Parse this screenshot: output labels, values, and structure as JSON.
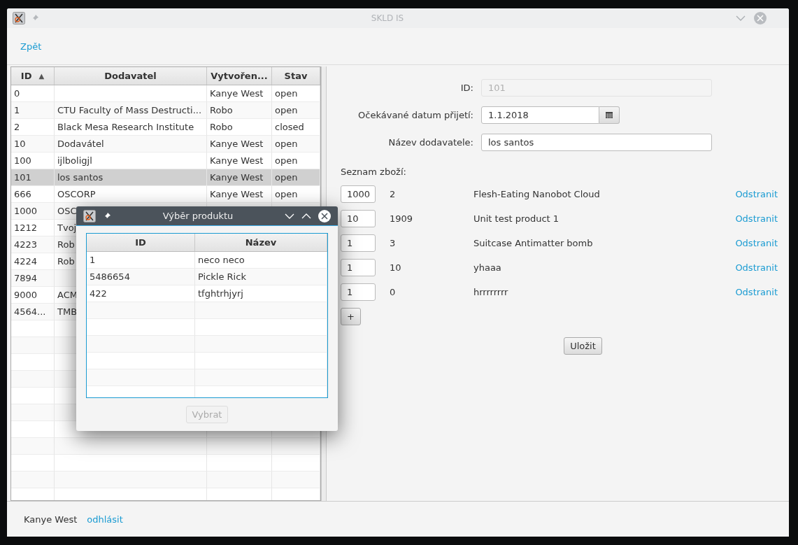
{
  "main_window": {
    "title": "SKLD IS"
  },
  "toolbar": {
    "back_link": "Zpět"
  },
  "orders_table": {
    "columns": [
      {
        "label": "ID",
        "sort_indicator": "▲"
      },
      {
        "label": "Dodavatel"
      },
      {
        "label": "Vytvořen..."
      },
      {
        "label": "Stav"
      }
    ],
    "rows": [
      {
        "id": "0",
        "creator": "Kanye West",
        "state": "open",
        "selected": false
      },
      {
        "id": "1",
        "supplier": "CTU Faculty of Mass Destructi...",
        "creator": "Robo",
        "state": "open",
        "selected": false
      },
      {
        "id": "2",
        "supplier": "Black Mesa Research Institute",
        "creator": "Robo",
        "state": "closed",
        "selected": false
      },
      {
        "id": "10",
        "supplier": "Dodavátel",
        "creator": "Kanye West",
        "state": "open",
        "selected": false
      },
      {
        "id": "100",
        "supplier": "ijlboligjl",
        "creator": "Kanye West",
        "state": "open",
        "selected": false
      },
      {
        "id": "101",
        "supplier": "los santos",
        "creator": "Kanye West",
        "state": "open",
        "selected": true
      },
      {
        "id": "666",
        "supplier": "OSCORP",
        "creator": "Kanye West",
        "state": "open",
        "selected": false
      },
      {
        "id": "1000",
        "supplier": "OSC",
        "selected": false
      },
      {
        "id": "1212",
        "supplier": "Tvoj",
        "selected": false
      },
      {
        "id": "4223",
        "supplier": "Rob",
        "selected": false
      },
      {
        "id": "4224",
        "supplier": "Rob",
        "selected": false
      },
      {
        "id": "7894",
        "selected": false
      },
      {
        "id": "9000",
        "supplier": "ACM",
        "selected": false
      },
      {
        "id": "4564...",
        "supplier": "TMB",
        "selected": false
      }
    ]
  },
  "form": {
    "fields": [
      {
        "kind": "text",
        "label": "ID:",
        "value": "101",
        "disabled": true
      },
      {
        "kind": "date",
        "label": "Očekávané datum přijetí:",
        "value": "1.1.2018",
        "disabled": false
      },
      {
        "kind": "text",
        "label": "Název dodavatele:",
        "value": "los santos",
        "disabled": false
      }
    ],
    "items_label": "Seznam zboží:",
    "items": [
      {
        "quantity": "1000",
        "product_id": "2",
        "name": "Flesh-Eating Nanobot Cloud",
        "remove_link": "Odstranit"
      },
      {
        "quantity": "10",
        "product_id": "1909",
        "name": "Unit test product 1",
        "remove_link": "Odstranit"
      },
      {
        "quantity": "1",
        "product_id": "3",
        "name": "Suitcase Antimatter bomb",
        "remove_link": "Odstranit"
      },
      {
        "quantity": "1",
        "product_id": "10",
        "name": "yhaaa",
        "remove_link": "Odstranit"
      },
      {
        "quantity": "1",
        "product_id": "0",
        "name": "hrrrrrrrr",
        "remove_link": "Odstranit"
      }
    ],
    "add_button": "+",
    "save_button": "Uložit"
  },
  "status_bar": {
    "user": "Kanye West",
    "logout_link": "odhlásit"
  },
  "dialog": {
    "title": "Výběr produktu",
    "columns": [
      "ID",
      "Název"
    ],
    "rows": [
      {
        "id": "1",
        "name": "neco neco"
      },
      {
        "id": "5486654",
        "name": "Pickle Rick"
      },
      {
        "id": "422",
        "name": "tfghtrhjyrj"
      }
    ],
    "select_button": {
      "label": "Vybrat",
      "disabled": true
    }
  }
}
